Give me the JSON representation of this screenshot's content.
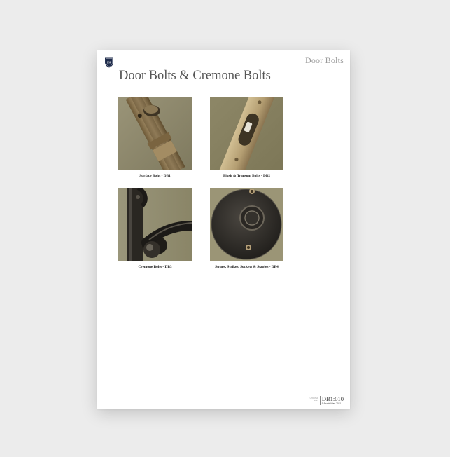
{
  "header": {
    "section_label": "Door Bolts",
    "title": "Door Bolts & Cremone Bolts",
    "logo_icon": "crest-shield-icon"
  },
  "products": [
    {
      "caption": "Surface Bolts - DB1",
      "image": "surface-bolt-photo"
    },
    {
      "caption": "Flush & Transom Bolts - DB2",
      "image": "flush-bolt-photo"
    },
    {
      "caption": "Cremone Bolts - DB3",
      "image": "cremone-bolt-photo"
    },
    {
      "caption": "Straps, Strikes, Sockets & Staples - DB4",
      "image": "strike-socket-photo"
    }
  ],
  "footer": {
    "meta_line_1": "UPDATED",
    "meta_line_2": "2021",
    "code": "DB1:010",
    "copyright": "© Frank Allart 2021"
  },
  "colors": {
    "background": "#ececec",
    "page": "#ffffff",
    "title": "#555555",
    "brass": "#b7a37a",
    "photo_backdrop": "#8f8a6e",
    "logo": "#1d2a4a"
  }
}
